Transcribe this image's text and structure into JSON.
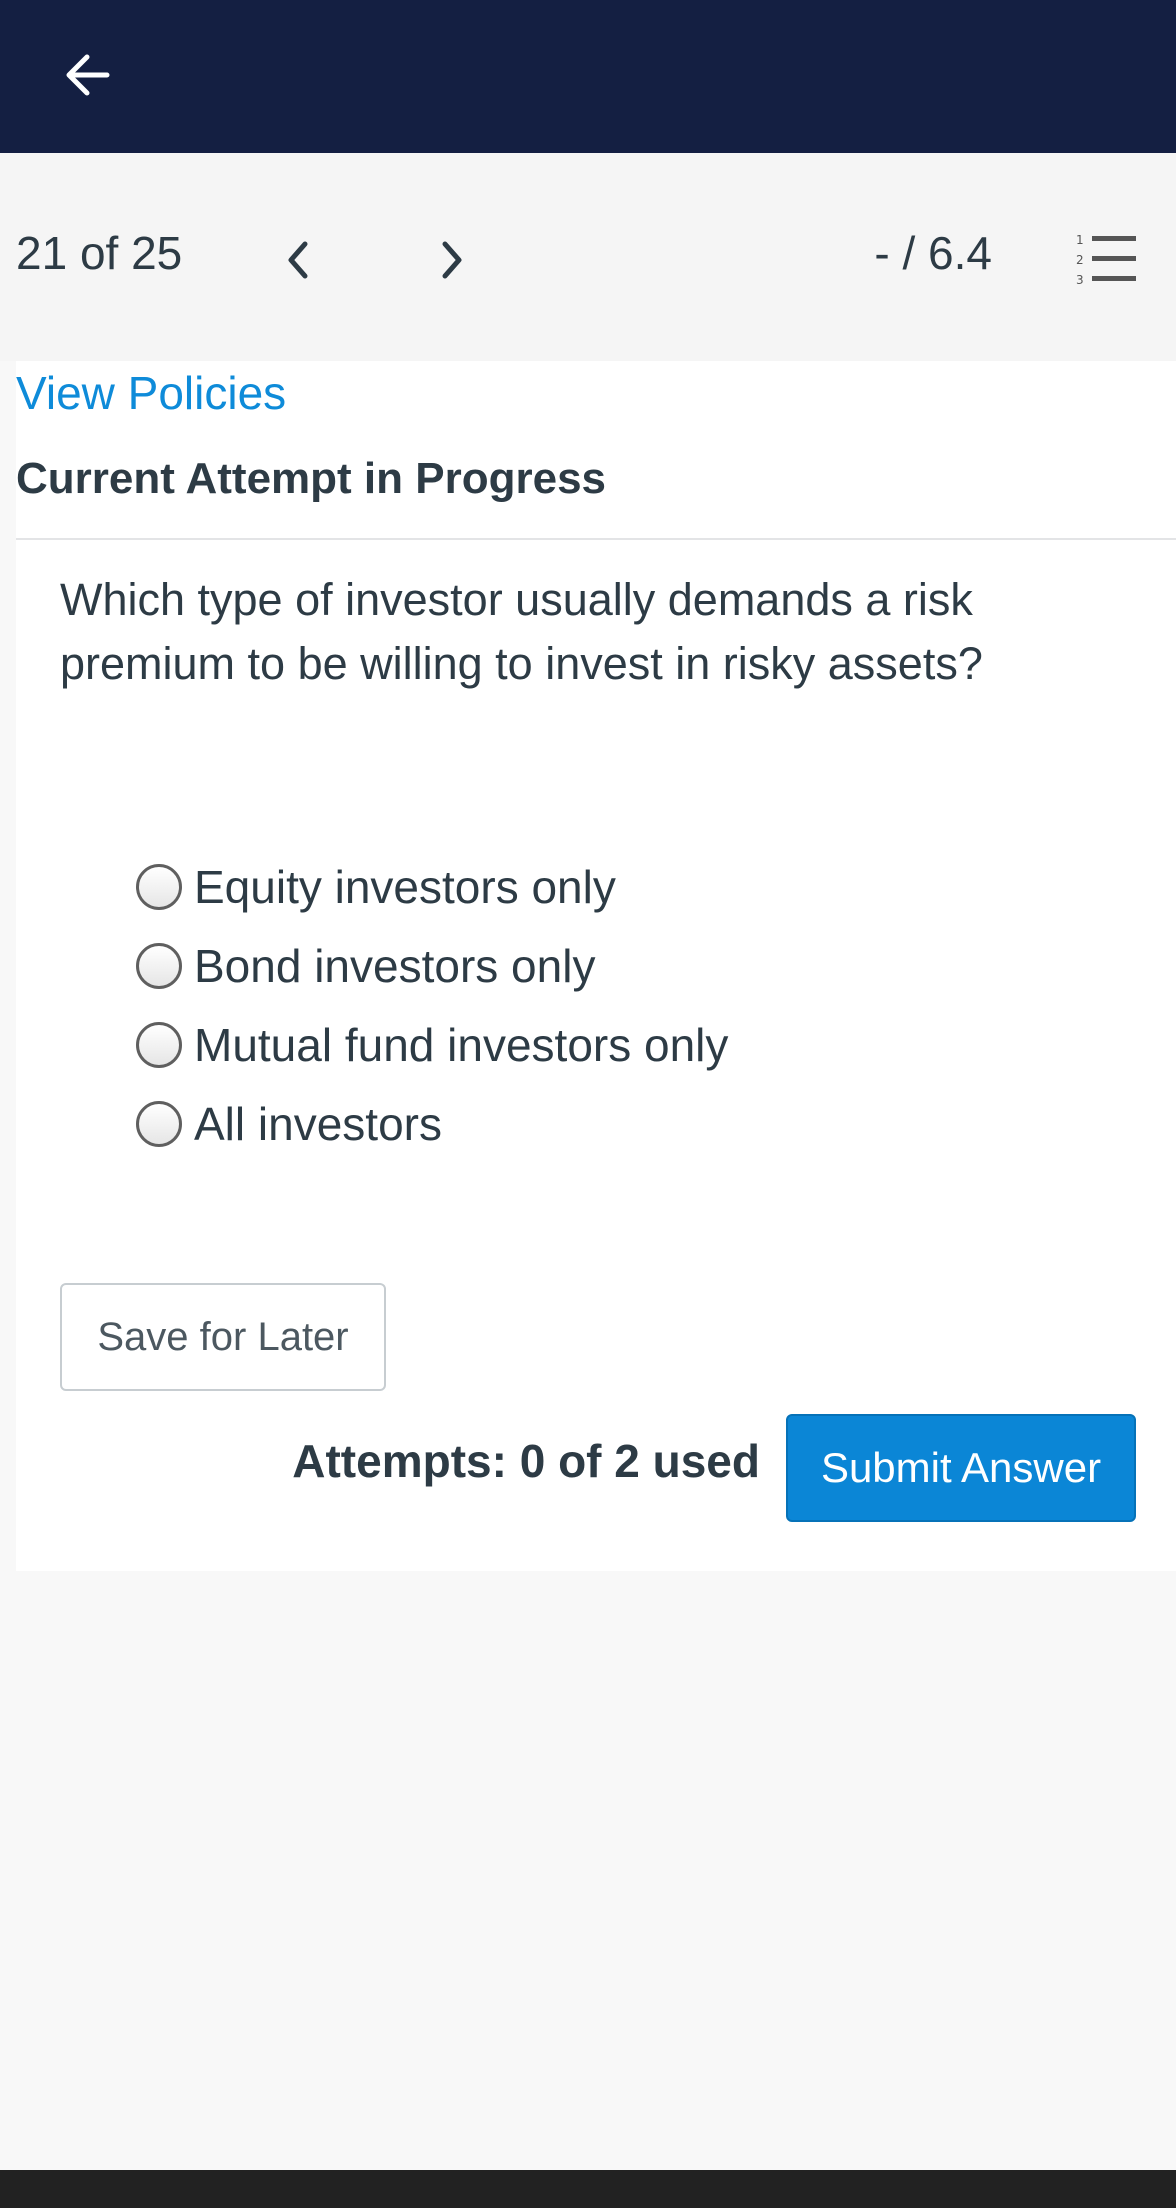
{
  "header": {
    "back_icon": "arrow-left-icon"
  },
  "nav": {
    "counter": "21 of 25",
    "prev_icon": "chevron-left-icon",
    "next_icon": "chevron-right-icon",
    "score": "- / 6.4",
    "list_icon": "numbered-list-icon"
  },
  "content": {
    "view_policies": "View Policies",
    "attempt_heading": "Current Attempt in Progress",
    "question": "Which type of investor usually demands a risk premium to be willing to invest in risky assets?",
    "options": [
      {
        "label": "Equity investors only"
      },
      {
        "label": "Bond investors only"
      },
      {
        "label": "Mutual fund investors only"
      },
      {
        "label": "All investors"
      }
    ]
  },
  "actions": {
    "save_label": "Save for Later",
    "attempts_text": "Attempts: 0 of 2 used",
    "submit_label": "Submit Answer"
  },
  "colors": {
    "header_bg": "#141f42",
    "link": "#0e8bd9",
    "submit_bg": "#0b86d6",
    "text": "#2d3b45"
  }
}
